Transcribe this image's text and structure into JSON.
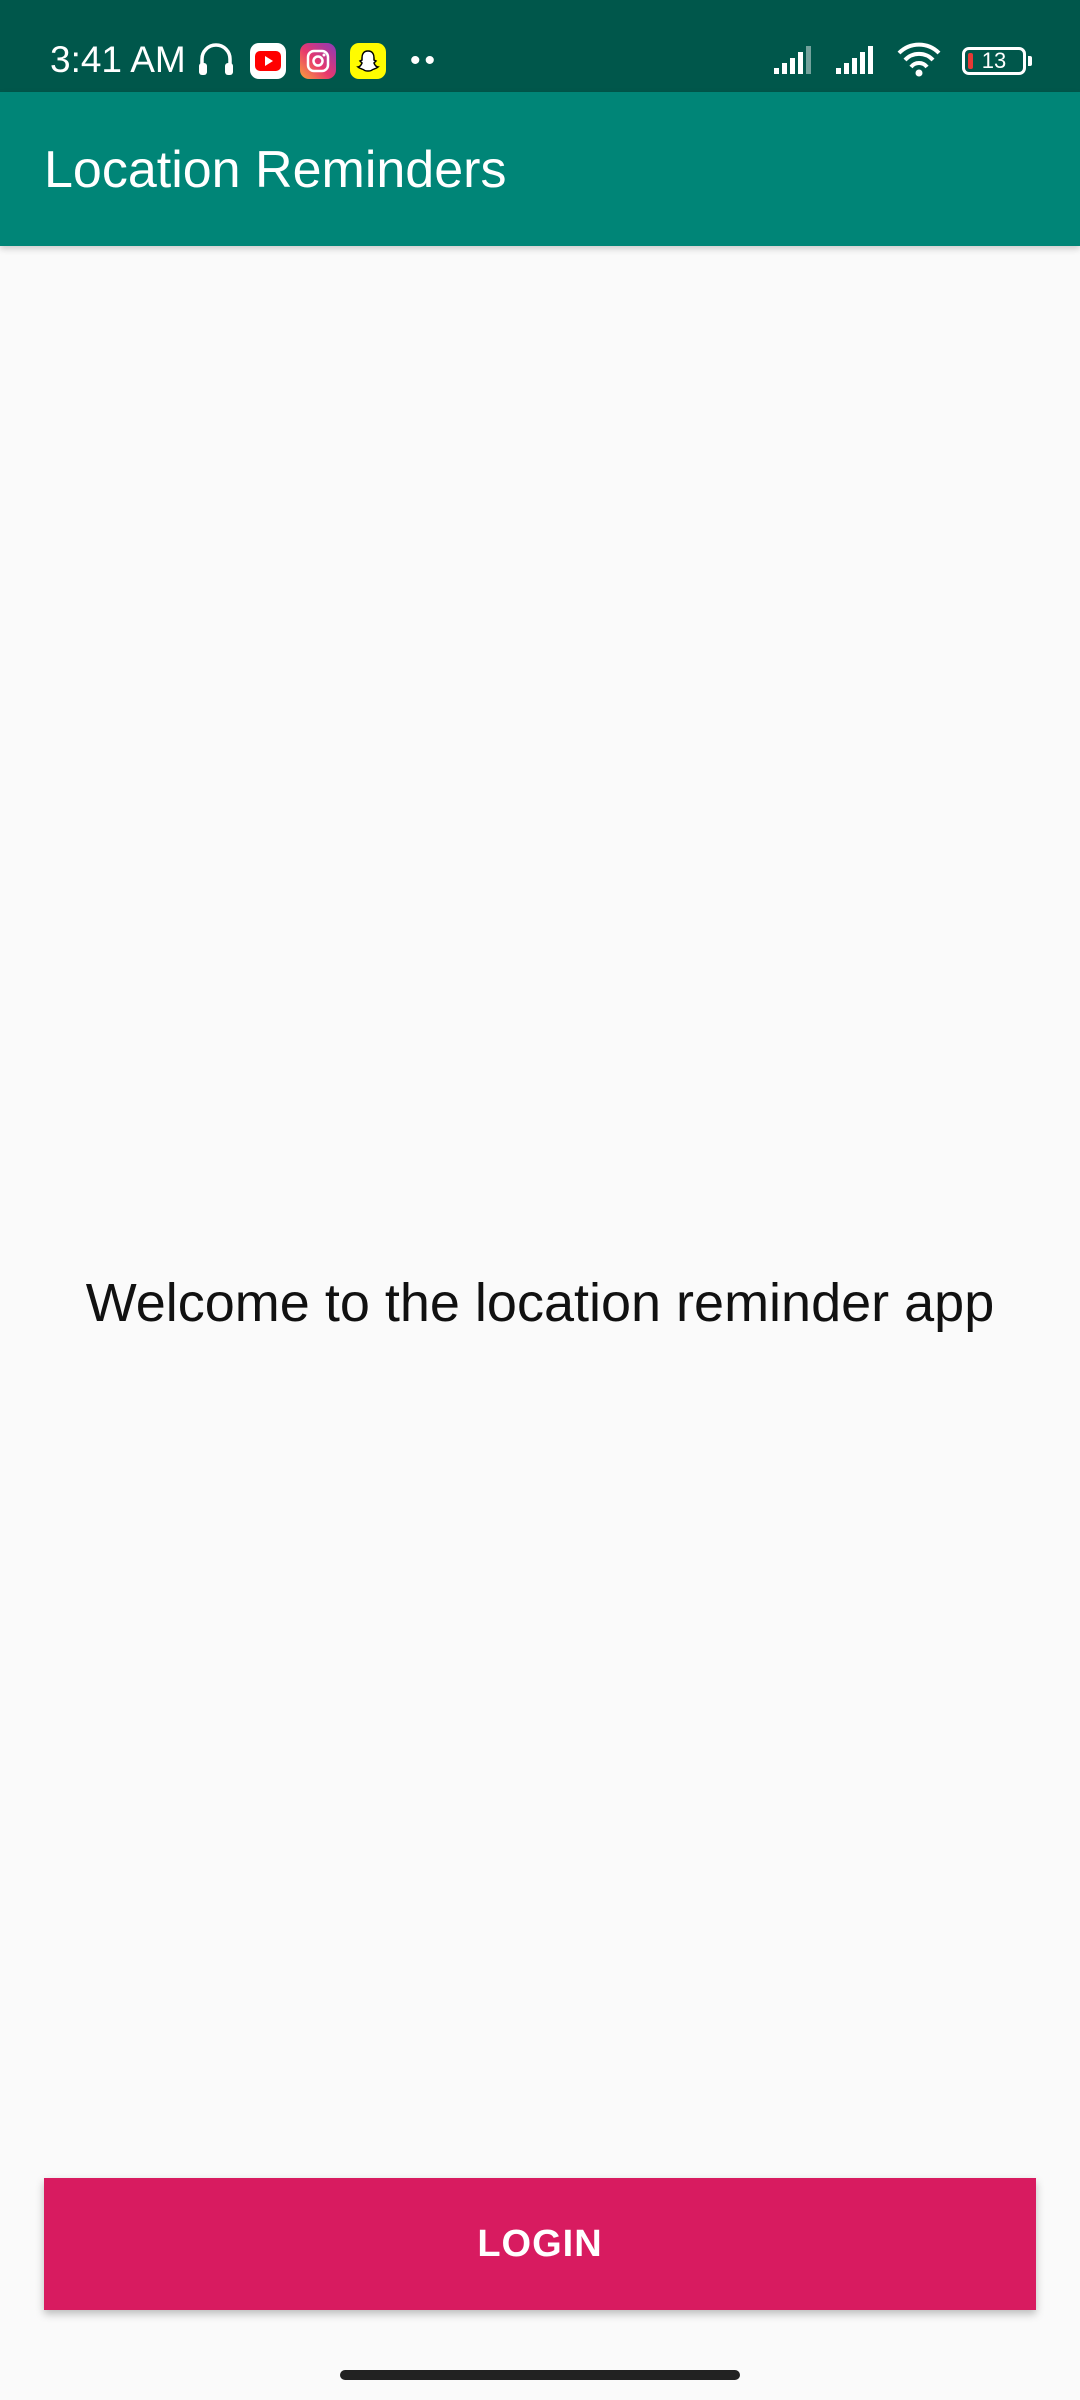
{
  "status_bar": {
    "time": "3:41 AM",
    "battery_level": "13",
    "background_color": "#00574b",
    "left_icons": [
      "headset-icon",
      "youtube-icon",
      "instagram-icon",
      "snapchat-icon",
      "more-notifications-icon"
    ],
    "right_icons": [
      "signal-icon",
      "signal-icon",
      "wifi-icon",
      "battery-icon"
    ]
  },
  "app_bar": {
    "title": "Location Reminders",
    "background_color": "#008577"
  },
  "main": {
    "welcome_text": "Welcome to the location reminder app"
  },
  "login_button": {
    "label": "LOGIN",
    "background_color": "#d81b60"
  }
}
